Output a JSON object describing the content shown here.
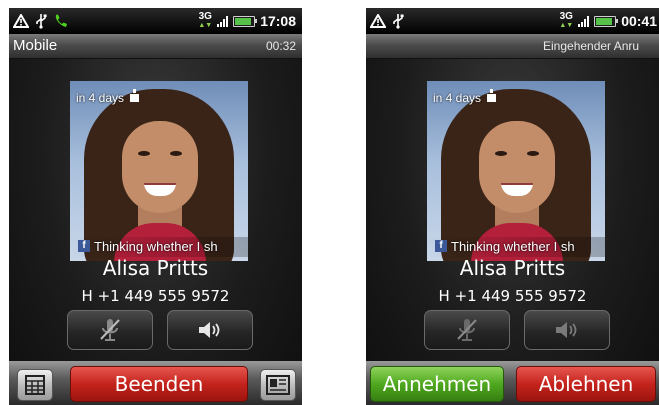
{
  "screens": [
    {
      "status_bar": {
        "time": "17:08",
        "network": "3G"
      },
      "title_bar": {
        "left": "Mobile",
        "right": "00:32"
      },
      "photo": {
        "status_top": "in 4 days",
        "fb_status": "Thinking whether I sh"
      },
      "caller": {
        "name": "Alisa Pritts",
        "number": "H +1 449 555 9572"
      },
      "bottom_bar": {
        "end_button": "Beenden"
      }
    },
    {
      "status_bar": {
        "time": "00:41",
        "network": "3G"
      },
      "title_bar": {
        "left": "",
        "right": "Eingehender Anru"
      },
      "photo": {
        "status_top": "in 4 days",
        "fb_status": "Thinking whether I sh"
      },
      "caller": {
        "name": "Alisa Pritts",
        "number": "H +1 449 555 9572"
      },
      "bottom_bar": {
        "answer_button": "Annehmen",
        "decline_button": "Ablehnen"
      }
    }
  ],
  "colors": {
    "end_red": "#c4231c",
    "answer_green": "#4fa81f",
    "facebook_blue": "#3b5998"
  },
  "icons": [
    "warning-icon",
    "usb-icon",
    "phone-icon",
    "signal-icon",
    "battery-icon",
    "mute-icon",
    "speaker-icon",
    "dialpad-icon",
    "contact-card-icon",
    "birthday-icon",
    "facebook-icon"
  ]
}
